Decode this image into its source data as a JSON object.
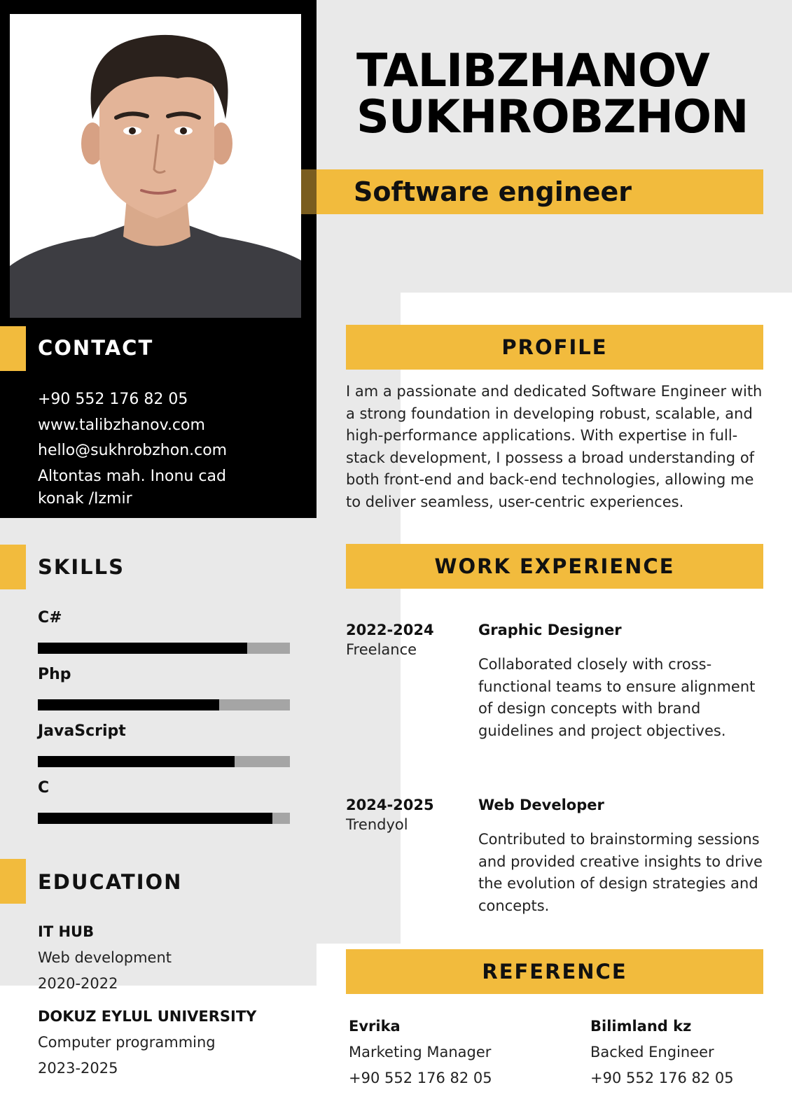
{
  "header": {
    "name_line1": "TALIBZHANOV",
    "name_line2": "SUKHROBZHON",
    "job_title": "Software engineer"
  },
  "contact": {
    "heading": "CONTACT",
    "phone": "+90 552 176 82 05",
    "website": "www.talibzhanov.com",
    "email": "hello@sukhrobzhon.com",
    "address_line1": "Altontas mah. Inonu cad",
    "address_line2": "konak /Izmir"
  },
  "skills": {
    "heading": "SKILLS",
    "items": [
      {
        "label": "C#",
        "level": 0.83
      },
      {
        "label": "Php",
        "level": 0.72
      },
      {
        "label": "JavaScript",
        "level": 0.78
      },
      {
        "label": "C",
        "level": 0.93
      }
    ]
  },
  "education": {
    "heading": "EDUCATION",
    "items": [
      {
        "school": "IT HUB",
        "program": "Web development",
        "years": "2020-2022"
      },
      {
        "school": "DOKUZ EYLUL UNIVERSITY",
        "program": "Computer programming",
        "years": "2023-2025"
      }
    ]
  },
  "profile": {
    "heading": "PROFILE",
    "text": "I am a passionate and dedicated Software Engineer with a strong foundation in developing robust, scalable, and high-performance applications. With expertise in full-stack development, I possess a broad understanding of both front-end and back-end technologies, allowing me to deliver seamless, user-centric experiences."
  },
  "work": {
    "heading": "WORK EXPERIENCE",
    "items": [
      {
        "years": "2022-2024",
        "company": "Freelance",
        "role": "Graphic Designer",
        "description": "Collaborated closely with cross-functional teams to ensure alignment of design concepts with brand guidelines and project objectives."
      },
      {
        "years": "2024-2025",
        "company": "Trendyol",
        "role": "Web Developer",
        "description": "Contributed to brainstorming sessions and provided creative insights to drive the evolution of design strategies and concepts."
      }
    ]
  },
  "reference": {
    "heading": "REFERENCE",
    "items": [
      {
        "name": "Evrika",
        "title": "Marketing Manager",
        "phone": "+90 552 176 82 05"
      },
      {
        "name": "Bilimland kz",
        "title": "Backed Engineer",
        "phone": "+90 552 176 82 05"
      }
    ]
  },
  "colors": {
    "accent": "#f2bb3d",
    "dark": "#000000",
    "panel_gray": "#e9e9e9",
    "bar_track": "#a5a5a5"
  }
}
